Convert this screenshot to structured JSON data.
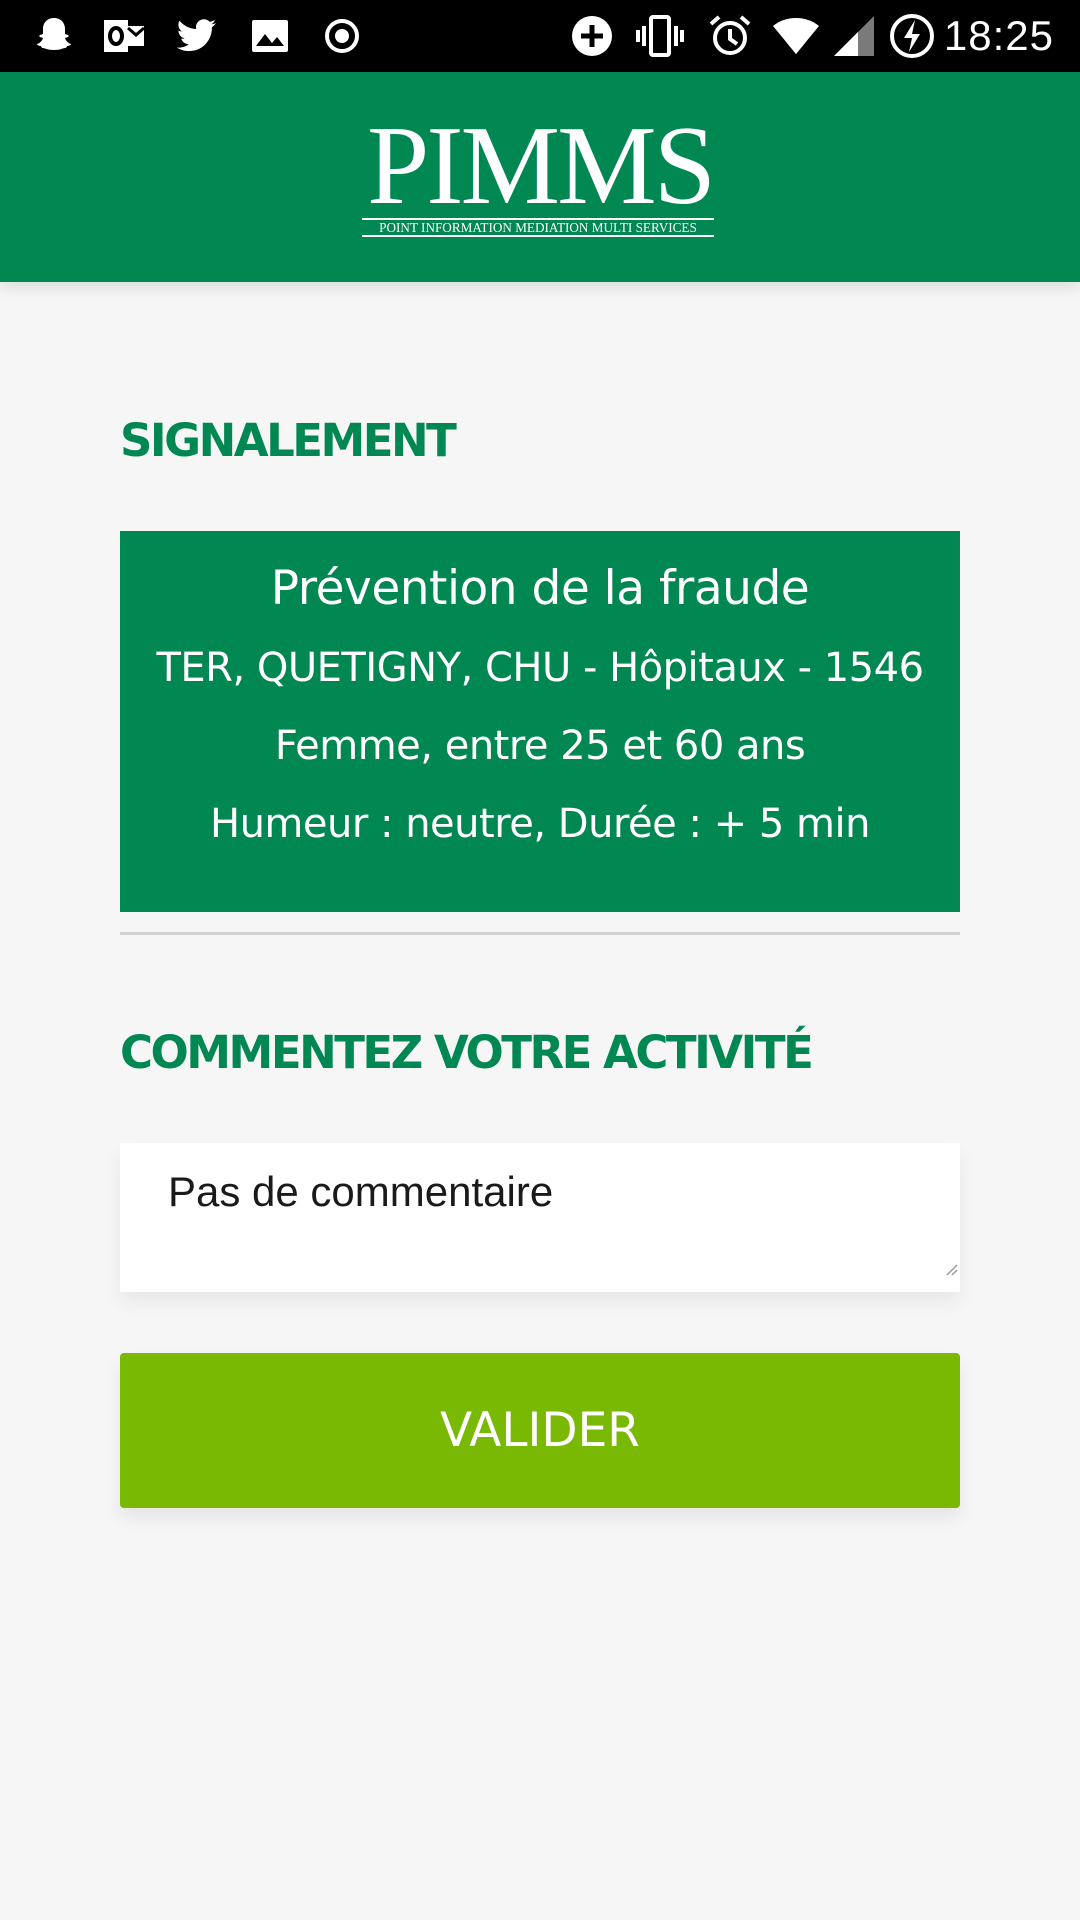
{
  "status_bar": {
    "time": "18:25",
    "left_icons": [
      "snapchat-icon",
      "outlook-icon",
      "twitter-icon",
      "gallery-icon",
      "record-icon"
    ],
    "right_icons": [
      "add-circle-icon",
      "vibrate-icon",
      "alarm-icon",
      "wifi-icon",
      "signal-icon",
      "battery-charging-icon"
    ]
  },
  "header": {
    "logo": "PIMMS",
    "tagline": "POINT INFORMATION MEDIATION MULTI SERVICES",
    "background": "#008752"
  },
  "report": {
    "section_title": "SIGNALEMENT",
    "title": "Prévention de la fraude",
    "location": "TER, QUETIGNY, CHU - Hôpitaux - 1546",
    "person": "Femme, entre 25 et 60 ans",
    "details": "Humeur : neutre, Durée : + 5 min"
  },
  "comment": {
    "section_title": "COMMENTEZ VOTRE ACTIVITÉ",
    "value": "Pas de commentaire"
  },
  "actions": {
    "validate_label": "VALIDER",
    "validate_color": "#79b803"
  }
}
